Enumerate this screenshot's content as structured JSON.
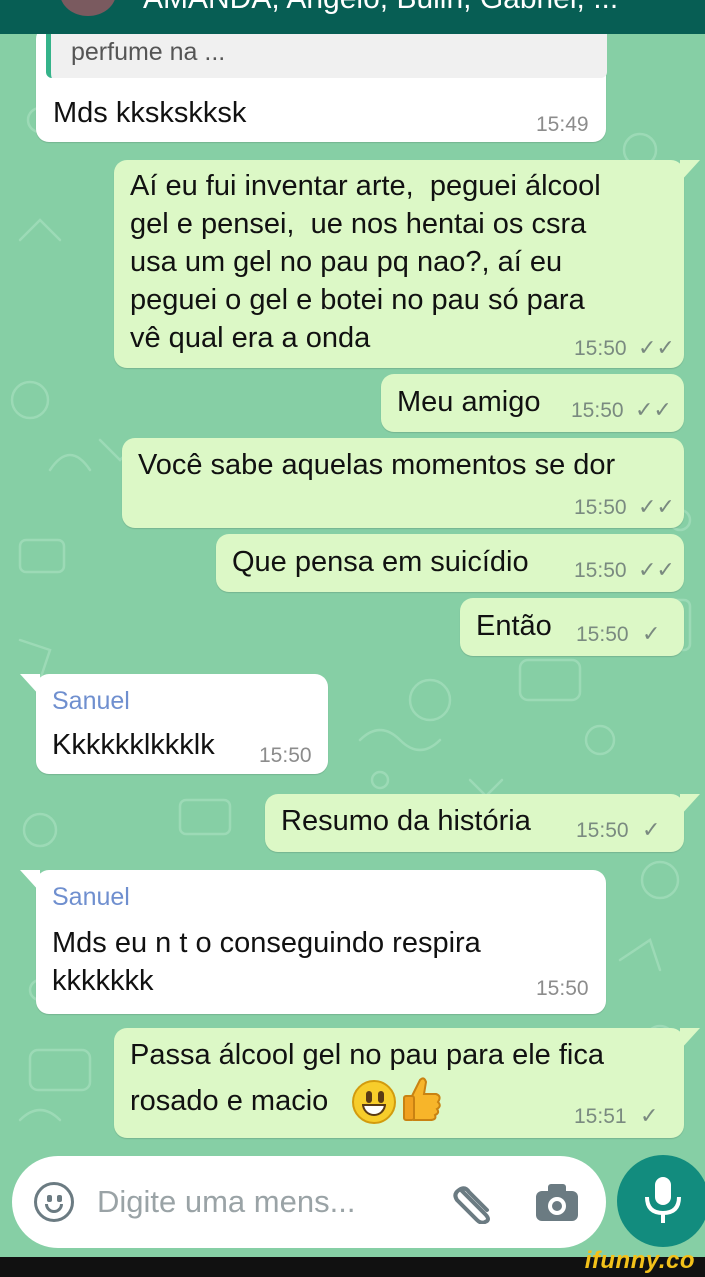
{
  "header": {
    "group_members": "AMANDA, Angelo, Bulin, Gabriel, ..."
  },
  "messages": [
    {
      "id": "m0",
      "type": "incoming",
      "quote": "perfume na ...",
      "text": "Mds kkskskksk",
      "time": "15:49"
    },
    {
      "id": "m1",
      "type": "outgoing",
      "lines": [
        "Aí eu fui inventar arte,  peguei álcool",
        "gel e pensei,  ue nos hentai os csra",
        "usa um gel no pau pq nao?, aí eu",
        "peguei o gel e botei no pau só para",
        "vê qual era a onda"
      ],
      "time": "15:50",
      "ticks": "✓✓"
    },
    {
      "id": "m2",
      "type": "outgoing",
      "text": "Meu amigo",
      "time": "15:50",
      "ticks": "✓✓"
    },
    {
      "id": "m3",
      "type": "outgoing",
      "text": "Você sabe aquelas momentos se dor",
      "time": "15:50",
      "ticks": "✓✓"
    },
    {
      "id": "m4",
      "type": "outgoing",
      "text": "Que pensa em suicídio",
      "time": "15:50",
      "ticks": "✓✓"
    },
    {
      "id": "m5",
      "type": "outgoing",
      "text": "Então",
      "time": "15:50",
      "ticks": "✓"
    },
    {
      "id": "m6",
      "type": "incoming",
      "sender": "Sanuel",
      "text": "Kkkkkklkkklk",
      "time": "15:50"
    },
    {
      "id": "m7",
      "type": "outgoing",
      "text": "Resumo da história",
      "time": "15:50",
      "ticks": "✓"
    },
    {
      "id": "m8",
      "type": "incoming",
      "sender": "Sanuel",
      "lines": [
        "Mds eu n t o conseguindo respira",
        "kkkkkkk"
      ],
      "time": "15:50"
    },
    {
      "id": "m9",
      "type": "outgoing",
      "lines": [
        "Passa álcool gel no pau para ele fica",
        "rosado e macio"
      ],
      "emojis": [
        "grinning-face",
        "thumbs-up"
      ],
      "time": "15:51",
      "ticks": "✓"
    }
  ],
  "composer": {
    "placeholder": "Digite uma mens..."
  },
  "watermark": "ifunny.co",
  "colors": {
    "wallpaper": "#86cfa5",
    "outgoing_bubble": "#dcf8c6",
    "incoming_bubble": "#ffffff",
    "header": "#075e54",
    "mic_button": "#128c7e",
    "sender_name": "#6f8fcf"
  }
}
